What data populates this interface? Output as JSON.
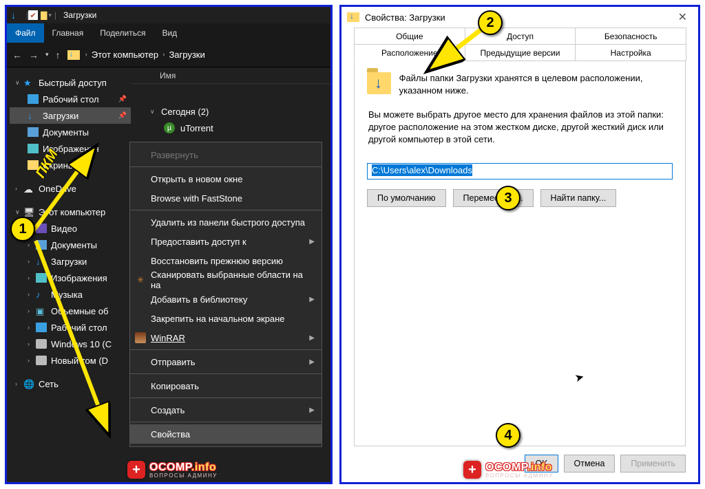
{
  "explorer": {
    "window_title": "Загрузки",
    "ribbon": {
      "file": "Файл",
      "home": "Главная",
      "share": "Поделиться",
      "view": "Вид"
    },
    "addr": {
      "pc": "Этот компьютер",
      "folder": "Загрузки"
    },
    "col_name": "Имя",
    "tree": {
      "quick": "Быстрый доступ",
      "desktop": "Рабочий стол",
      "downloads": "Загрузки",
      "documents": "Документы",
      "pictures": "Изображения",
      "screenshots": "Скриншоты",
      "onedrive": "OneDrive",
      "thispc": "Этот компьютер",
      "video": "Видео",
      "documents2": "Документы",
      "downloads2": "Загрузки",
      "pictures2": "Изображения",
      "music": "Музыка",
      "obj3d": "Объемные об",
      "desktop2": "Рабочий стол",
      "win10": "Windows 10 (C",
      "newvol": "Новый том (D",
      "network": "Сеть"
    },
    "group": {
      "today": "Сегодня (2)",
      "utorrent": "uTorrent"
    },
    "ctx": {
      "expand": "Развернуть",
      "open_new": "Открыть в новом окне",
      "faststone": "Browse with FastStone",
      "unpin": "Удалить из панели быстрого доступа",
      "share": "Предоставить доступ к",
      "restore": "Восстановить прежнюю версию",
      "scan": "Сканировать выбранные области на на",
      "addlib": "Добавить в библиотеку",
      "pinstart": "Закрепить на начальном экране",
      "winrar": "WinRAR",
      "send": "Отправить",
      "copy": "Копировать",
      "create": "Создать",
      "props": "Свойства"
    }
  },
  "dlg": {
    "title": "Свойства: Загрузки",
    "tabs": {
      "general": "Общие",
      "access": "Доступ",
      "security": "Безопасность",
      "location": "Расположение",
      "prev": "Предыдущие версии",
      "customize": "Настройка"
    },
    "desc": "Файлы папки Загрузки хранятся в целевом расположении, указанном ниже.",
    "desc2": "Вы можете выбрать другое место для хранения файлов из этой папки: другое расположение на этом жестком диске, другой жесткий диск или другой компьютер в этой сети.",
    "path": "C:\\Users\\alex\\Downloads",
    "btn_default": "По умолчанию",
    "btn_move": "Переместить...",
    "btn_find": "Найти папку...",
    "ok": "OK",
    "cancel": "Отмена",
    "apply": "Применить"
  },
  "anno": {
    "pkm": "ПКМ",
    "n1": "1",
    "n2": "2",
    "n3": "3",
    "n4": "4"
  },
  "watermark": {
    "main": "OCOMP",
    "suffix": ".info",
    "sub": "ВОПРОСЫ АДМИНУ"
  }
}
